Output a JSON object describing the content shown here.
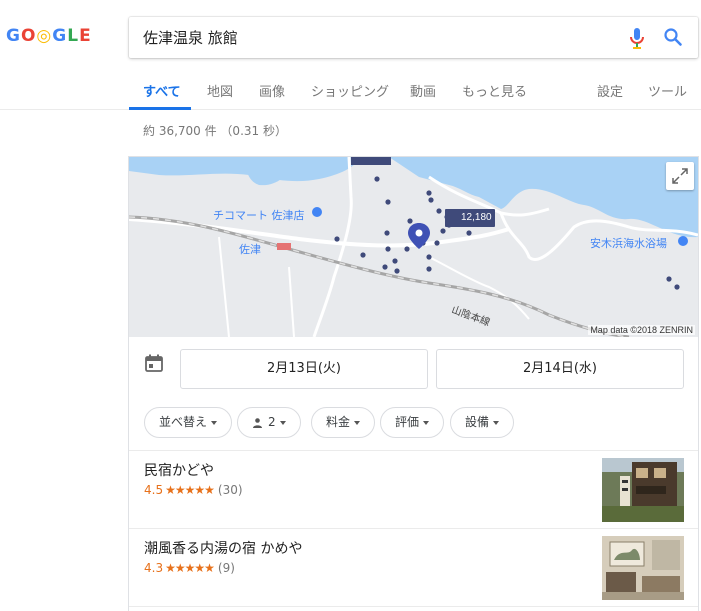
{
  "logo": {
    "letters": [
      "G",
      "O",
      "◎",
      "G",
      "L",
      "E"
    ]
  },
  "search": {
    "query": "佐津温泉 旅館"
  },
  "tabs": [
    {
      "label": "すべて"
    },
    {
      "label": "地図"
    },
    {
      "label": "画像"
    },
    {
      "label": "ショッピング"
    },
    {
      "label": "動画"
    },
    {
      "label": "もっと見る"
    },
    {
      "label": "設定"
    },
    {
      "label": "ツール"
    }
  ],
  "result_stats": "約 36,700 件 （0.31 秒）",
  "map": {
    "labels": {
      "store": "チコマート 佐津店",
      "station": "佐津",
      "beach": "安木浜海水浴場",
      "rail": "山陰本線",
      "price_pin": "12,180"
    },
    "attribution": "Map data ©2018 ZENRIN"
  },
  "dates": {
    "checkin": "2月13日(火)",
    "checkout": "2月14日(水)"
  },
  "chips": {
    "sort": "並べ替え",
    "guests": "2",
    "price": "料金",
    "rating": "評価",
    "amenities": "設備"
  },
  "listings": [
    {
      "name": "民宿かどや",
      "rating": "4.5",
      "stars": "★★★★★",
      "reviews": "(30)"
    },
    {
      "name": "潮風香る内湯の宿 かめや",
      "rating": "4.3",
      "stars": "★★★★★",
      "reviews": "(9)"
    }
  ],
  "colors": {
    "accent": "#1a73e8",
    "star": "#e7711b",
    "sea": "#a9d2f5",
    "land": "#e8eaed"
  }
}
